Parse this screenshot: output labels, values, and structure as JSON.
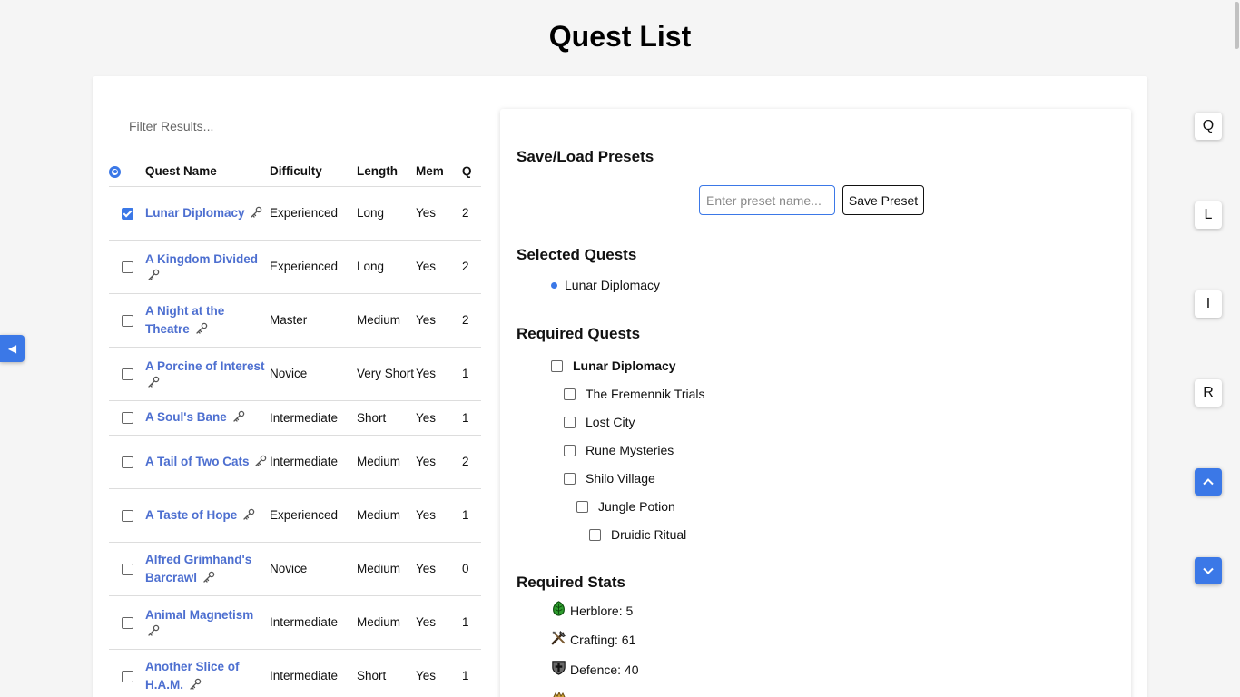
{
  "title": "Quest List",
  "filter": {
    "placeholder": "Filter Results..."
  },
  "table": {
    "headers": {
      "name": "Quest Name",
      "difficulty": "Difficulty",
      "length": "Length",
      "members": "Mem",
      "q": "Q"
    },
    "rows": [
      {
        "name": "Lunar Diplomacy",
        "difficulty": "Experienced",
        "length": "Long",
        "members": "Yes",
        "q": "2",
        "checked": true
      },
      {
        "name": "A Kingdom Divided",
        "difficulty": "Experienced",
        "length": "Long",
        "members": "Yes",
        "q": "2",
        "checked": false
      },
      {
        "name": "A Night at the Theatre",
        "difficulty": "Master",
        "length": "Medium",
        "members": "Yes",
        "q": "2",
        "checked": false
      },
      {
        "name": "A Porcine of Interest",
        "difficulty": "Novice",
        "length": "Very Short",
        "members": "Yes",
        "q": "1",
        "checked": false
      },
      {
        "name": "A Soul's Bane",
        "difficulty": "Intermediate",
        "length": "Short",
        "members": "Yes",
        "q": "1",
        "checked": false
      },
      {
        "name": "A Tail of Two Cats",
        "difficulty": "Intermediate",
        "length": "Medium",
        "members": "Yes",
        "q": "2",
        "checked": false
      },
      {
        "name": "A Taste of Hope",
        "difficulty": "Experienced",
        "length": "Medium",
        "members": "Yes",
        "q": "1",
        "checked": false
      },
      {
        "name": "Alfred Grimhand's Barcrawl",
        "difficulty": "Novice",
        "length": "Medium",
        "members": "Yes",
        "q": "0",
        "checked": false
      },
      {
        "name": "Animal Magnetism",
        "difficulty": "Intermediate",
        "length": "Medium",
        "members": "Yes",
        "q": "1",
        "checked": false
      },
      {
        "name": "Another Slice of H.A.M.",
        "difficulty": "Intermediate",
        "length": "Short",
        "members": "Yes",
        "q": "1",
        "checked": false
      }
    ]
  },
  "panel": {
    "presets_heading": "Save/Load Presets",
    "preset_placeholder": "Enter preset name...",
    "save_label": "Save Preset",
    "selected_heading": "Selected Quests",
    "selected": [
      "Lunar Diplomacy"
    ],
    "required_heading": "Required Quests",
    "required": [
      {
        "label": "Lunar Diplomacy",
        "level": 0
      },
      {
        "label": "The Fremennik Trials",
        "level": 1
      },
      {
        "label": "Lost City",
        "level": 1
      },
      {
        "label": "Rune Mysteries",
        "level": 1
      },
      {
        "label": "Shilo Village",
        "level": 1
      },
      {
        "label": "Jungle Potion",
        "level": 2
      },
      {
        "label": "Druidic Ritual",
        "level": 3
      }
    ],
    "stats_heading": "Required Stats",
    "stats": [
      {
        "label": "Herblore: 5",
        "icon": "herblore-icon"
      },
      {
        "label": "Crafting: 61",
        "icon": "crafting-icon"
      },
      {
        "label": "Defence: 40",
        "icon": "defence-icon"
      }
    ]
  },
  "side_buttons": {
    "q": "Q",
    "l": "L",
    "i": "I",
    "r": "R"
  },
  "colors": {
    "accent": "#3b78e7",
    "link": "#4d6fd0"
  }
}
